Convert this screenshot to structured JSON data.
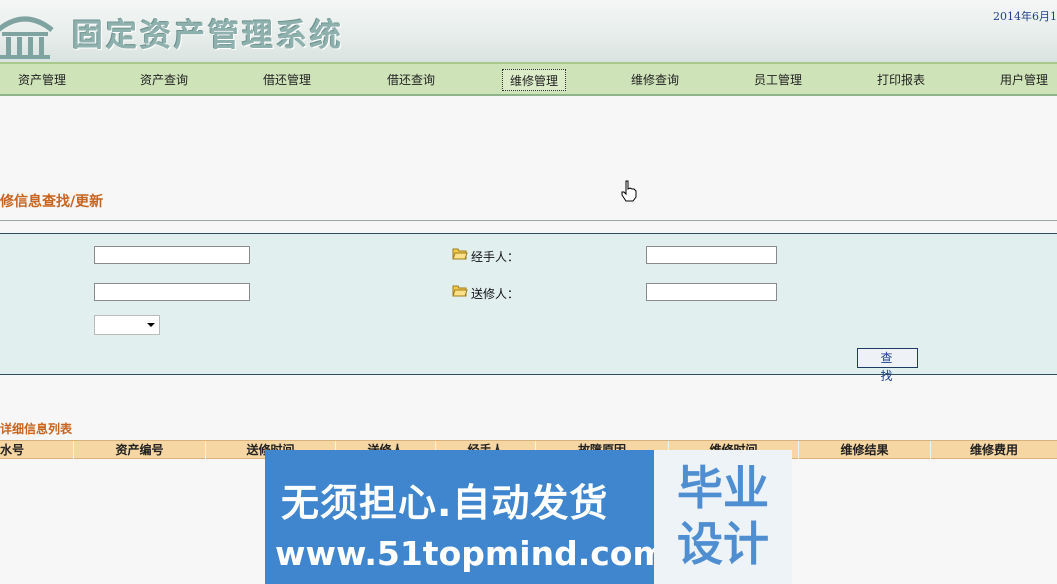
{
  "header": {
    "title": "固定资产管理系统",
    "date": "2014年6月1"
  },
  "nav": {
    "items": [
      {
        "label": "资产管理"
      },
      {
        "label": "资产查询"
      },
      {
        "label": "借还管理"
      },
      {
        "label": "借还查询"
      },
      {
        "label": "维修管理"
      },
      {
        "label": "维修查询"
      },
      {
        "label": "员工管理"
      },
      {
        "label": "打印报表"
      },
      {
        "label": "用户管理"
      }
    ],
    "active_index": 4
  },
  "section": {
    "title": "修信息查找/更新"
  },
  "search": {
    "handler_label": "经手人：",
    "sender_label": "送修人：",
    "field1_value": "",
    "field2_value": "",
    "handler_value": "",
    "sender_value": "",
    "select_value": "",
    "button_label": "查 找"
  },
  "list": {
    "title": "详细信息列表",
    "columns": [
      "水号",
      "资产编号",
      "送修时间",
      "送修人",
      "经手人",
      "故障原因",
      "维修时间",
      "维修结果",
      "维修费用"
    ]
  },
  "ad": {
    "line1": "无须担心.自动发货",
    "line2": "www.51topmind.com",
    "box_line1": "毕业",
    "box_line2": "设计"
  },
  "colors": {
    "nav_bg": "#cfe3b8",
    "panel_bg": "#e1efef",
    "accent_orange": "#c8641e",
    "table_header_bg": "#f6d6a2",
    "ad_bg": "#3f86cf"
  }
}
